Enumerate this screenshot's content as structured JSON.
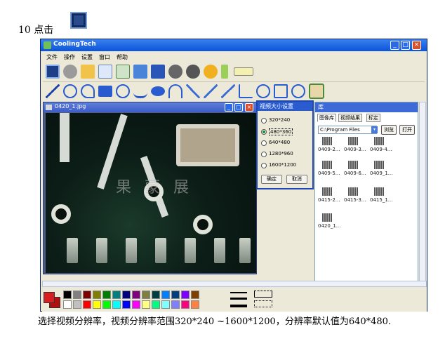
{
  "document": {
    "step_text": "10 点击",
    "caption": "选择视频分辨率，视频分辨率范围320*240 ~1600*1200，分辨率默认值为640*480."
  },
  "app": {
    "title": "CoolingTech",
    "menu": [
      "文件",
      "操作",
      "设置",
      "窗口",
      "帮助"
    ],
    "toolbar1_icons": [
      "video-capture-icon",
      "camera-icon",
      "folder-open-icon",
      "edit-image-icon",
      "export-icon",
      "swap-icon",
      "save-icon",
      "pause-icon",
      "stop-icon",
      "settings-wrench-icon",
      "ruler-vertical-icon",
      "ruler-horizontal-icon"
    ],
    "toolbar2_icons": [
      "line-tool-icon",
      "zoom-tool-icon",
      "lasso-tool-icon",
      "rectangle-tool-icon",
      "circle-tool-icon",
      "curve-tool-icon",
      "ellipse-tool-icon",
      "arc-tool-icon",
      "angle-tool-icon",
      "angle2-tool-icon",
      "measure-tool-icon",
      "angle3-tool-icon",
      "diameter-tool-icon",
      "text-tool-icon",
      "align-tool-icon",
      "color-picker-icon"
    ]
  },
  "image_window": {
    "title": "0420_1.jpg",
    "watermark": "果   蒙   展"
  },
  "dialog": {
    "title": "视频大小设置",
    "options": [
      "320*240",
      "480*360",
      "640*480",
      "1280*960",
      "1600*1200"
    ],
    "selected": "480*360",
    "ok_label": "确定",
    "cancel_label": "取消"
  },
  "library": {
    "title": "库",
    "tabs": [
      "图像库",
      "视频结果",
      "标定"
    ],
    "path": "C:\\Program Files",
    "browse_label": "浏览",
    "open_label": "打开",
    "thumbnails": [
      "0409-2...",
      "0409-3...",
      "0409-4...",
      "0409-5...",
      "0409-6...",
      "0409_1...",
      "0415-2...",
      "0415-3...",
      "0415_1...",
      "0420_1..."
    ]
  },
  "palette": {
    "row1": [
      "#000000",
      "#808080",
      "#800000",
      "#808000",
      "#008000",
      "#008080",
      "#000080",
      "#800080",
      "#808040",
      "#004040",
      "#0080ff",
      "#004080",
      "#8000ff",
      "#804000"
    ],
    "row2": [
      "#ffffff",
      "#c0c0c0",
      "#ff0000",
      "#ffff00",
      "#00ff00",
      "#00ffff",
      "#0000ff",
      "#ff00ff",
      "#ffff80",
      "#00ff80",
      "#80ffff",
      "#8080ff",
      "#ff0080",
      "#ff8040"
    ]
  }
}
